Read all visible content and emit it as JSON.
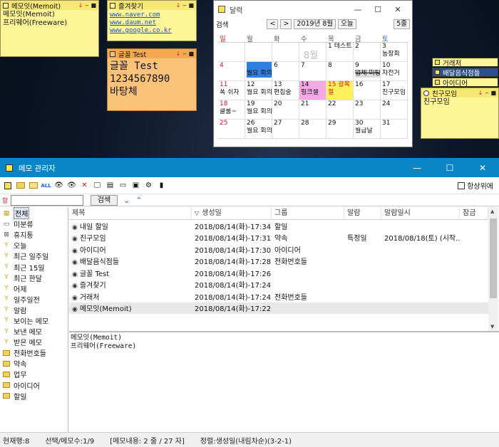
{
  "sticky_notes": {
    "memoit": {
      "title": "메모잇(Memoit)",
      "lines": [
        "메모잇(Memoit)",
        "프리웨어(Freeware)"
      ]
    },
    "favorites": {
      "title": "즐겨찾기",
      "links": [
        "www.naver.com",
        "www.daum.net",
        "www.google.co.kr"
      ]
    },
    "font_test": {
      "title": "글꼴 Test",
      "lines": [
        "글꼴 Test",
        "1234567890",
        "바탕체"
      ]
    }
  },
  "note_controls": {
    "pin": "↓",
    "min": "‒",
    "close": "■"
  },
  "calendar": {
    "title": "달력",
    "search_label": "검색",
    "prev_label": "<",
    "next_label": ">",
    "month_label": "2019년 8월",
    "today_label": "오늘",
    "view_label": "5줄",
    "weekday_headers": [
      "일",
      "월",
      "화",
      "수",
      "목",
      "금",
      "토"
    ],
    "month_watermark": "8월",
    "weeks": [
      [
        {
          "d": ""
        },
        {
          "d": ""
        },
        {
          "d": ""
        },
        {
          "d": ""
        },
        {
          "d": "1",
          "ev": "테스트"
        },
        {
          "d": "2"
        },
        {
          "d": "3",
          "ev": "동창회"
        }
      ],
      [
        {
          "d": "4"
        },
        {
          "d": "5",
          "ev": "월요 회의"
        },
        {
          "d": "6"
        },
        {
          "d": "7"
        },
        {
          "d": "8"
        },
        {
          "d": "9",
          "ev": "업체 미팅"
        },
        {
          "d": "10",
          "ev": "자전거"
        }
      ],
      [
        {
          "d": "11",
          "ev": "폭 쉬자"
        },
        {
          "d": "12",
          "ev": "월요 회의"
        },
        {
          "d": "13",
          "ev": "편집중"
        },
        {
          "d": "14",
          "ev": "핑크셀"
        },
        {
          "d": "15 광복절"
        },
        {
          "d": "16"
        },
        {
          "d": "17",
          "ev": "친구모임"
        }
      ],
      [
        {
          "d": "18",
          "ev": "클룸~"
        },
        {
          "d": "19",
          "ev": "월요 회의"
        },
        {
          "d": "20"
        },
        {
          "d": "21"
        },
        {
          "d": "22"
        },
        {
          "d": "23"
        },
        {
          "d": "24"
        }
      ],
      [
        {
          "d": "25"
        },
        {
          "d": "26",
          "ev": "월요 회의"
        },
        {
          "d": "27"
        },
        {
          "d": "28"
        },
        {
          "d": "29"
        },
        {
          "d": "30",
          "ev": "월급날"
        },
        {
          "d": "31"
        }
      ]
    ]
  },
  "right_notes": [
    "거래처",
    "배달음식점들",
    "아이디어",
    "친구모임"
  ],
  "right_note_body": "친구모임",
  "manager": {
    "title": "메모 관리자",
    "topmost_label": "항상위에",
    "search_icon_label": "항",
    "search_placeholder": "",
    "search_button": "검색",
    "tree": [
      {
        "label": "전체",
        "icon": "all"
      },
      {
        "label": "미분류",
        "icon": "uncat"
      },
      {
        "label": "휴지통",
        "icon": "trash"
      },
      {
        "label": "오늘",
        "icon": "filter"
      },
      {
        "label": "최근 일주일",
        "icon": "filter"
      },
      {
        "label": "최근 15일",
        "icon": "filter"
      },
      {
        "label": "최근 한달",
        "icon": "filter"
      },
      {
        "label": "어제",
        "icon": "filter"
      },
      {
        "label": "일주일전",
        "icon": "filter"
      },
      {
        "label": "알람",
        "icon": "filter"
      },
      {
        "label": "보이는 메모",
        "icon": "filter"
      },
      {
        "label": "보낸 메모",
        "icon": "filter"
      },
      {
        "label": "받은 메모",
        "icon": "filter"
      },
      {
        "label": "전화번호들",
        "icon": "folder"
      },
      {
        "label": "약속",
        "icon": "folder"
      },
      {
        "label": "업무",
        "icon": "folder"
      },
      {
        "label": "아이디어",
        "icon": "folder"
      },
      {
        "label": "할일",
        "icon": "folder"
      }
    ],
    "columns": [
      "제목",
      "생성일",
      "그룹",
      "알람",
      "알람일시",
      "잠금"
    ],
    "rows": [
      {
        "title": "내일 할일",
        "created": "2018/08/14(화)-17:34...",
        "group": "할일",
        "alarm": "",
        "alarm_time": ""
      },
      {
        "title": "친구모임",
        "created": "2018/08/14(화)-17:31...",
        "group": "약속",
        "alarm": "특정일",
        "alarm_time": "2018/08/18(토) (시작..."
      },
      {
        "title": "아이디어",
        "created": "2018/08/14(화)-17:30...",
        "group": "아이디어",
        "alarm": "",
        "alarm_time": ""
      },
      {
        "title": "배달음식점들",
        "created": "2018/08/14(화)-17:28...",
        "group": "전화번호들",
        "alarm": "",
        "alarm_time": ""
      },
      {
        "title": "글꼴 Test",
        "created": "2018/08/14(화)-17:26...",
        "group": "",
        "alarm": "",
        "alarm_time": ""
      },
      {
        "title": "즐겨찾기",
        "created": "2018/08/14(화)-17:24...",
        "group": "",
        "alarm": "",
        "alarm_time": ""
      },
      {
        "title": "거래처",
        "created": "2018/08/14(화)-17:24...",
        "group": "전화번호들",
        "alarm": "",
        "alarm_time": ""
      },
      {
        "title": "메모잇(Memoit)",
        "created": "2018/08/14(화)-17:22...",
        "group": "",
        "alarm": "",
        "alarm_time": ""
      }
    ],
    "preview_lines": [
      "메모잇(Memoit)",
      "프리웨어(Freeware)"
    ],
    "status": {
      "count": "현재행:8",
      "selection": "선택/메모수:1/9",
      "content": "[메모내용: 2 줄 / 27 자]",
      "sort": "정렬:생성일(내림차순)(3-2-1)"
    }
  },
  "colors": {
    "note_yellow": "#fdf598",
    "note_title_yellow": "#f7e775",
    "note_orange": "#fbc27a",
    "note_orange_title": "#f6a851",
    "titlebar_blue": "#0a86c6",
    "cal_blue_event": "#2f7fe0",
    "cal_pink_event": "#f5a8e6",
    "cal_yellow_event": "#fff15a",
    "cal_gray_event": "#dcdcdc",
    "holiday_red": "#d21a1a"
  }
}
